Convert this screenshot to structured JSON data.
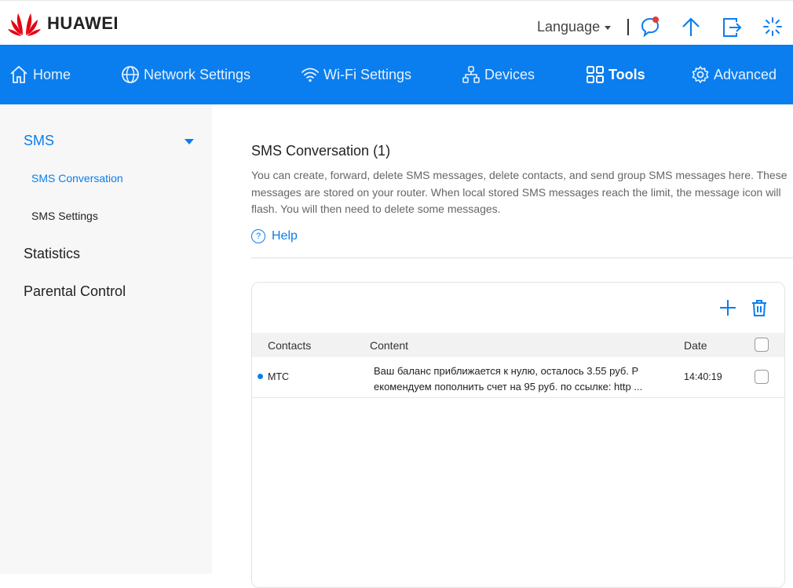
{
  "header": {
    "brand": "HUAWEI",
    "language_label": "Language",
    "icons": [
      "chat-icon",
      "arrow-up-icon",
      "logout-icon",
      "spinner-icon"
    ]
  },
  "nav": {
    "items": [
      {
        "label": "Home",
        "icon": "home-icon"
      },
      {
        "label": "Network Settings",
        "icon": "globe-icon"
      },
      {
        "label": "Wi-Fi Settings",
        "icon": "wifi-icon"
      },
      {
        "label": "Devices",
        "icon": "devices-icon"
      },
      {
        "label": "Tools",
        "icon": "tools-icon",
        "active": true
      },
      {
        "label": "Advanced",
        "icon": "gear-icon"
      }
    ]
  },
  "sidebar": {
    "sms": "SMS",
    "sms_conversation": "SMS Conversation",
    "sms_settings": "SMS Settings",
    "statistics": "Statistics",
    "parental_control": "Parental Control"
  },
  "main": {
    "title": "SMS Conversation (1)",
    "description": "You can create, forward, delete SMS messages, delete contacts, and send group SMS messages here. These messages are stored on your router. When local stored SMS messages reach the limit, the message icon will flash. You will then need to delete some messages.",
    "help": "Help"
  },
  "table": {
    "columns": {
      "contacts": "Contacts",
      "content": "Content",
      "date": "Date"
    },
    "rows": [
      {
        "contact": "МТС",
        "content_line1": "Ваш баланс приближается к нулю, осталось 3.55 руб. Р",
        "content_line2": "екомендуем пополнить счет на 95 руб. по ссылке: http ...",
        "date": "14:40:19",
        "unread": true
      }
    ]
  },
  "colors": {
    "accent": "#0a7eee",
    "logo_red": "#e60012",
    "notification": "#e53935"
  }
}
